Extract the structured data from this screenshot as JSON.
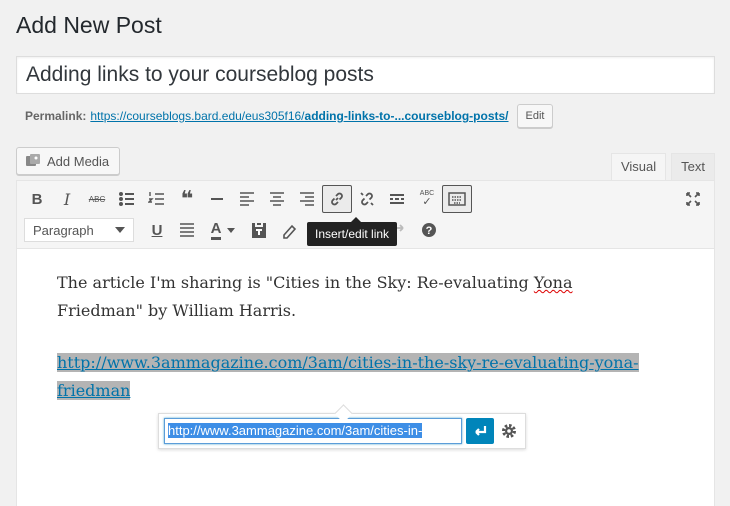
{
  "page_title": "Add New Post",
  "post_title": "Adding links to your courseblog posts",
  "permalink": {
    "label": "Permalink:",
    "url_base": "https://courseblogs.bard.edu/eus305f16/",
    "url_slug": "adding-links-to-...courseblog-posts/",
    "edit_label": "Edit"
  },
  "add_media_label": "Add Media",
  "tabs": {
    "visual": "Visual",
    "text": "Text"
  },
  "toolbar": {
    "format_value": "Paragraph",
    "tooltip": "Insert/edit link"
  },
  "content": {
    "para1_part1": "The article I'm sharing is \"Cities in the Sky: Re-evaluating ",
    "para1_spell": "Yona",
    "para1_part2": " Friedman\" by William Harris.",
    "link_text": "http://www.3ammagazine.com/3am/cities-in-the-sky-re-evaluating-yona-friedman"
  },
  "link_popup": {
    "url_value": "http://www.3ammagazine.com/3am/cities-in-"
  },
  "colors": {
    "accent": "#0073aa",
    "apply_button": "#0085ba"
  }
}
